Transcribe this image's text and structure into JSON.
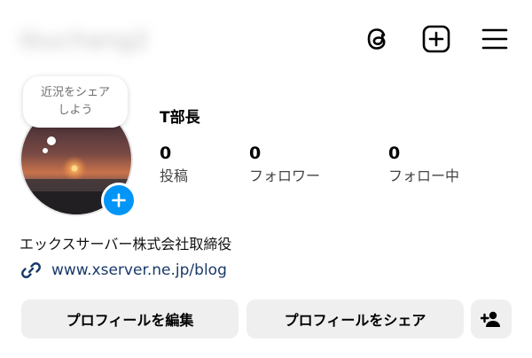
{
  "header": {
    "username": "tkuchang2",
    "icons": [
      "threads-icon",
      "create-plus-icon",
      "menu-icon"
    ]
  },
  "profile": {
    "note_bubble_line1": "近況をシェア",
    "note_bubble_line2": "しよう",
    "display_name": "T部長",
    "stats": [
      {
        "count": "0",
        "label": "投稿"
      },
      {
        "count": "0",
        "label": "フォロワー"
      },
      {
        "count": "0",
        "label": "フォロー中"
      }
    ],
    "bio": "エックスサーバー株式会社取締役",
    "link": "www.xserver.ne.jp/blog"
  },
  "actions": {
    "edit_profile": "プロフィールを編集",
    "share_profile": "プロフィールをシェア"
  },
  "colors": {
    "accent": "#0095f6",
    "link": "#1a3a6b",
    "button_bg": "#efefef"
  }
}
